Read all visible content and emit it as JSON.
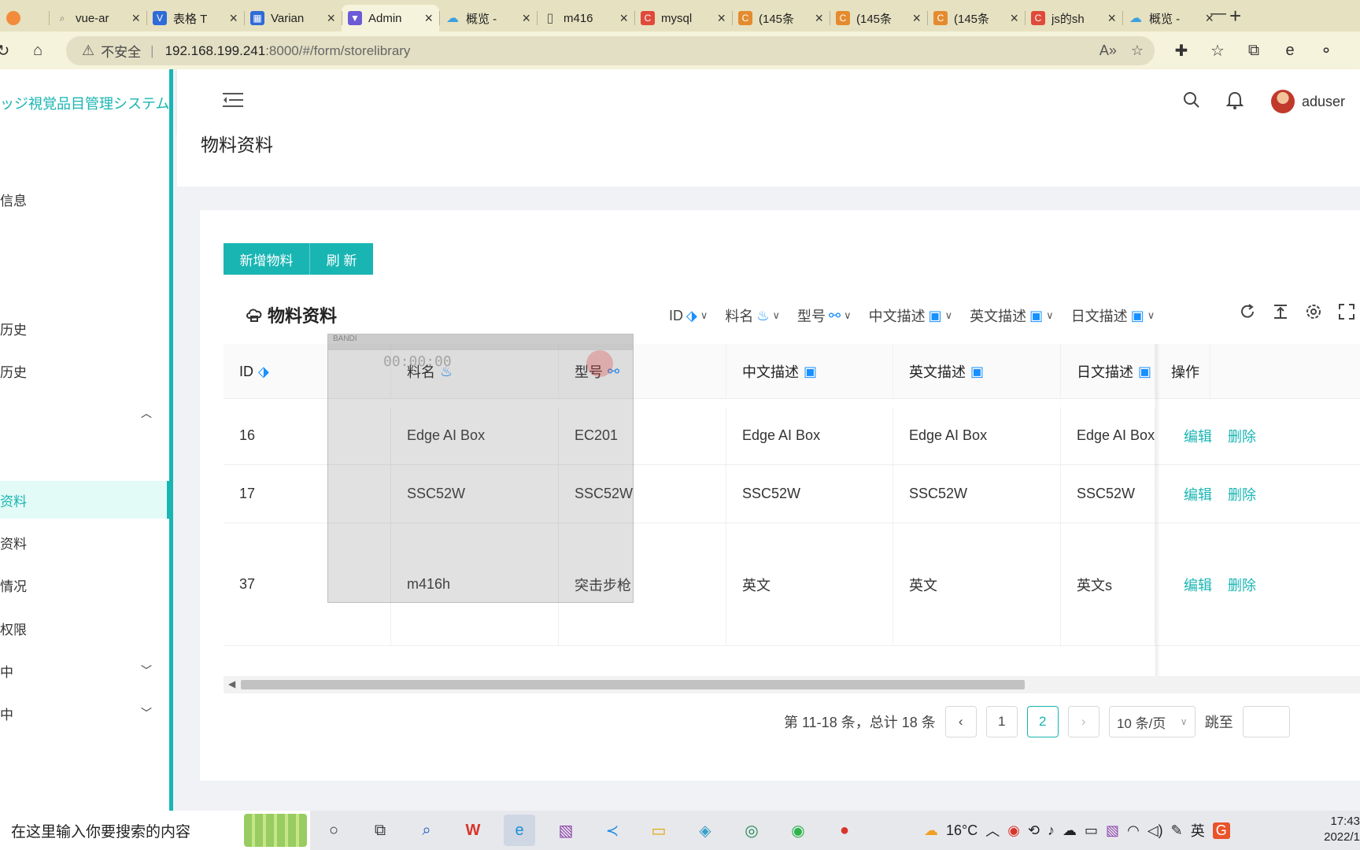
{
  "browser": {
    "tabs": [
      {
        "title": "",
        "icon": "ball-icon",
        "color": "#f28c3c"
      },
      {
        "title": "vue-ar",
        "icon": "search-icon",
        "color": "#888888"
      },
      {
        "title": "表格 T",
        "icon": "vue-icon",
        "color": "#2f6bd8"
      },
      {
        "title": "Varian",
        "icon": "grid-icon",
        "color": "#2f6bd8"
      },
      {
        "title": "Admin",
        "icon": "vite-icon",
        "color": "#6b5bd6",
        "active": true
      },
      {
        "title": "概览 -",
        "icon": "cloud-icon",
        "color": "#3ca0e0"
      },
      {
        "title": "m416",
        "icon": "file-icon",
        "color": "#555555"
      },
      {
        "title": "mysql",
        "icon": "csdn-icon",
        "color": "#e04a3a"
      },
      {
        "title": "(145条",
        "icon": "csdn-icon",
        "color": "#e58b2f"
      },
      {
        "title": "(145条",
        "icon": "csdn-icon",
        "color": "#e58b2f"
      },
      {
        "title": "(145条",
        "icon": "csdn-icon",
        "color": "#e58b2f"
      },
      {
        "title": "js的sh",
        "icon": "csdn-icon",
        "color": "#e04a3a"
      },
      {
        "title": "概览 -",
        "icon": "cloud-icon",
        "color": "#3ca0e0"
      }
    ],
    "address": {
      "insecure_label": "不安全",
      "host": "192.168.199.241",
      "path": ":8000/#/form/storelibrary"
    }
  },
  "sidebar": {
    "system_title": "ッジ視覚品目管理システム",
    "items": [
      {
        "label": "信息",
        "top": 0
      },
      {
        "label": "历史"
      },
      {
        "label": "历史"
      },
      {
        "label": "",
        "arrow": "^"
      },
      {
        "label": "资料",
        "active": true
      },
      {
        "label": "资料"
      },
      {
        "label": "情况"
      },
      {
        "label": "权限"
      },
      {
        "label": "中",
        "arrow": "v"
      },
      {
        "label": "中",
        "arrow": "v"
      }
    ]
  },
  "header": {
    "username": "aduser"
  },
  "page": {
    "title": "物料资料",
    "buttons": {
      "add": "新增物料",
      "refresh": "刷 新"
    },
    "table_title": "物料资料",
    "filters": [
      "ID",
      "料名",
      "型号",
      "中文描述",
      "英文描述",
      "日文描述"
    ],
    "columns": [
      "ID",
      "料名",
      "型号",
      "中文描述",
      "英文描述",
      "日文描述",
      "操作"
    ],
    "rows": [
      {
        "id": "16",
        "name": "Edge AI Box",
        "model": "EC201",
        "zh": "Edge AI Box",
        "en": "Edge AI Box",
        "ja": "Edge AI Box"
      },
      {
        "id": "17",
        "name": "SSC52W",
        "model": "SSC52W",
        "zh": "SSC52W",
        "en": "SSC52W",
        "ja": "SSC52W"
      },
      {
        "id": "37",
        "name": "m416h",
        "model": "突击步枪",
        "zh": "英文",
        "en": "英文",
        "ja": "英文s"
      }
    ],
    "actions": {
      "edit": "编辑",
      "delete": "删除"
    },
    "pagination": {
      "summary": "第 11-18 条，总计 18 条",
      "pages": [
        "1",
        "2"
      ],
      "current": "2",
      "page_size": "10 条/页",
      "jump_label": "跳至"
    }
  },
  "recorder": {
    "brand": "BANDI",
    "time": "00:00:00"
  },
  "taskbar": {
    "search_placeholder": "在这里输入你要搜索的内容",
    "temperature": "16°C",
    "ime": "英",
    "time": "17:43",
    "date": "2022/1"
  },
  "colors": {
    "accent": "#19b5b3"
  }
}
